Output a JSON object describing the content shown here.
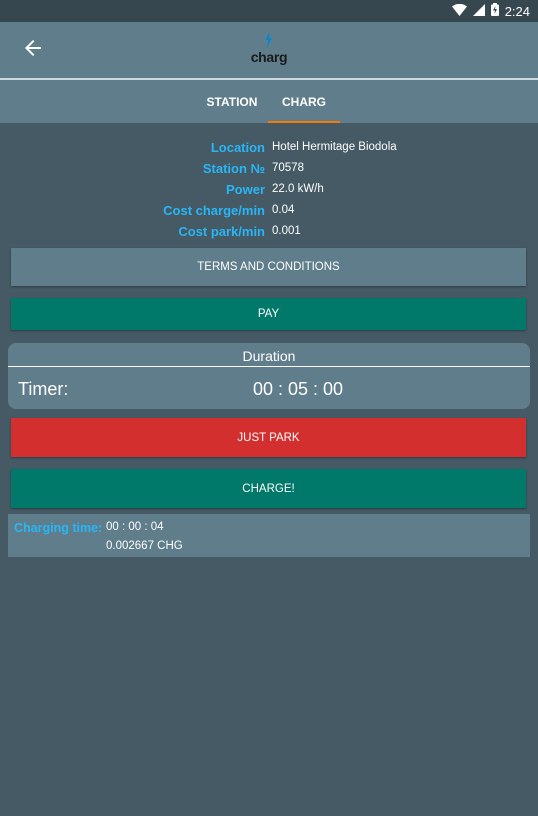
{
  "status_bar": {
    "time": "2:24"
  },
  "app_bar": {
    "logo_text": "charg"
  },
  "tabs": [
    {
      "label": "STATION",
      "active": false
    },
    {
      "label": "CHARG",
      "active": true
    }
  ],
  "info": [
    {
      "label": "Location",
      "value": "Hotel Hermitage Biodola"
    },
    {
      "label": "Station №",
      "value": "70578"
    },
    {
      "label": "Power",
      "value": "22.0 kW/h"
    },
    {
      "label": "Cost charge/min",
      "value": "0.04"
    },
    {
      "label": "Cost park/min",
      "value": "0.001"
    }
  ],
  "buttons": {
    "terms": "TERMS AND CONDITIONS",
    "pay": "PAY",
    "just_park": "JUST PARK",
    "charge": "CHARGE!"
  },
  "duration": {
    "title": "Duration",
    "timer_label": "Timer:",
    "timer_value": "00 : 05 : 00"
  },
  "charging": {
    "label": "Charging time:",
    "time": "00 : 00 : 04",
    "cost": "0.002667 CHG"
  },
  "colors": {
    "background": "#455a64",
    "toolbar": "#607d8b",
    "accent_blue": "#29b6f6",
    "tab_indicator": "#f57c00",
    "teal_button": "#00796b",
    "red_button": "#d32f2f"
  }
}
